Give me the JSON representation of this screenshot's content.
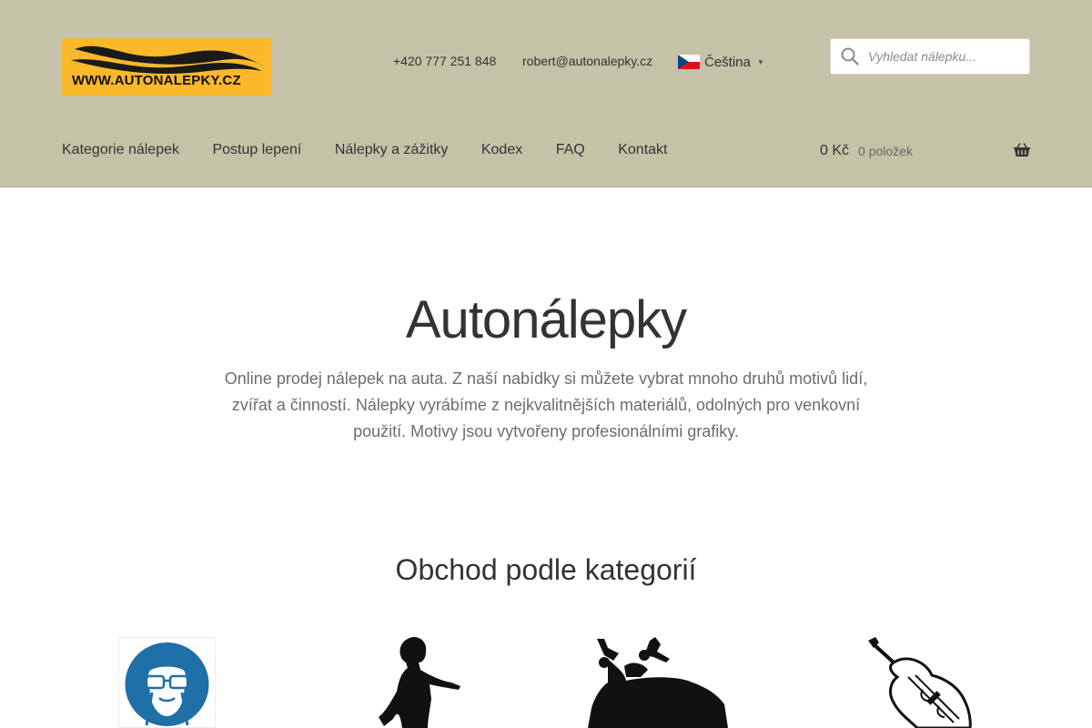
{
  "header": {
    "logo": {
      "text": "WWW.AUTONALEPKY.CZ"
    },
    "phone": "+420 777 251 848",
    "email": "robert@autonalepky.cz",
    "language": {
      "selected": "Čeština",
      "flag_icon": "czech-flag-icon",
      "options_visible": [
        "Čeština"
      ]
    },
    "search": {
      "placeholder": "Vyhledat nálepku...",
      "value": "",
      "icon": "search-icon"
    }
  },
  "nav": {
    "items": [
      {
        "label": "Kategorie nálepek"
      },
      {
        "label": "Postup lepení"
      },
      {
        "label": "Nálepky a zážitky"
      },
      {
        "label": "Kodex"
      },
      {
        "label": "FAQ"
      },
      {
        "label": "Kontakt"
      }
    ]
  },
  "cart": {
    "amount": "0 Kč",
    "count": "0 položek",
    "icon": "basket-icon"
  },
  "hero": {
    "title": "Autonálepky",
    "description": "Online prodej nálepek na auta. Z naší nabídky si můžete vybrat mnoho druhů motivů lidí, zvířat a činností. Nálepky vyrábíme z nejkvalitnějších materiálů, odolných pro venkovní použití. Motivy jsou vytvořeny profesionálními grafiky."
  },
  "categories": {
    "title": "Obchod podle kategorií",
    "items": [
      {
        "icon": "safety-goggles-sign-icon"
      },
      {
        "icon": "child-silhouette-icon"
      },
      {
        "icon": "motorcycle-icon"
      },
      {
        "icon": "cello-icon"
      }
    ]
  },
  "colors": {
    "header_bg": "#c5c3a7",
    "logo_bg": "#fbb82a",
    "text": "#333333",
    "muted_text": "#6d6d6d",
    "sign_blue": "#1f6fa8"
  }
}
